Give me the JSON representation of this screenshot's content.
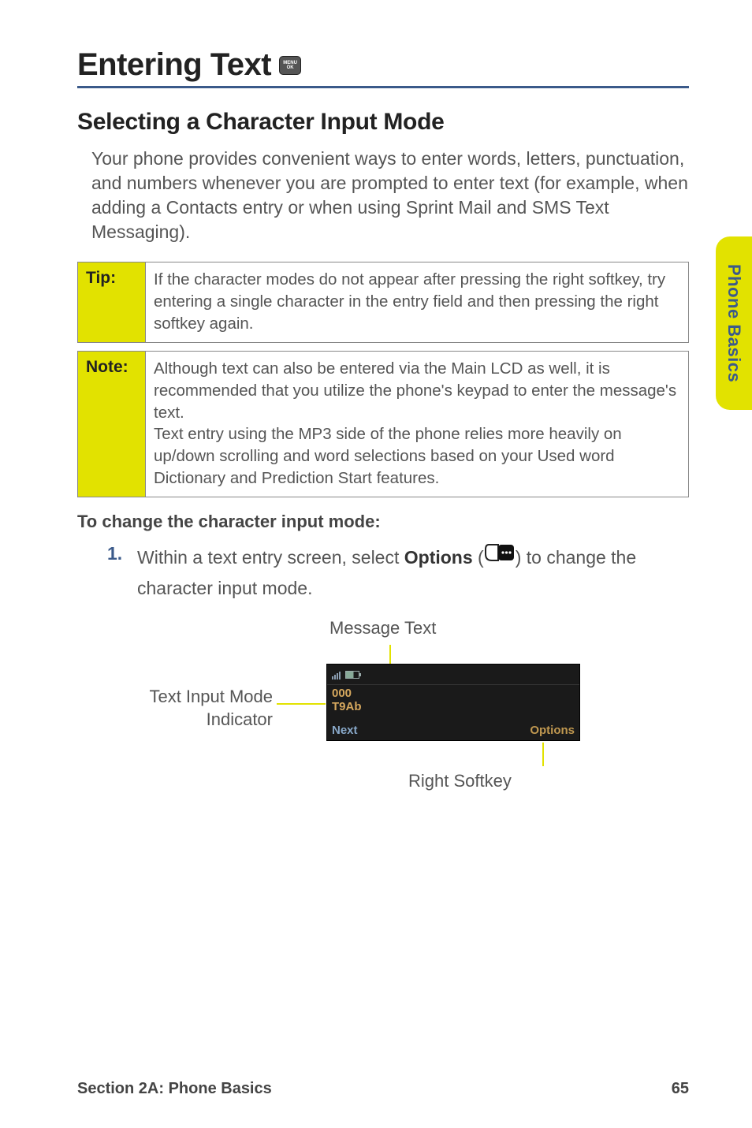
{
  "header": {
    "title": "Entering Text",
    "icon_name": "menu-ok-key-icon"
  },
  "section_heading": "Selecting a Character Input Mode",
  "intro_paragraph": "Your phone provides convenient ways to enter words, letters, punctuation, and numbers whenever you are prompted to enter text (for example, when adding a Contacts entry or when using Sprint Mail and SMS Text Messaging).",
  "tip_box": {
    "label": "Tip:",
    "text": "If the character modes do not appear after pressing the right softkey, try entering a single character in the entry field and then pressing the right softkey again."
  },
  "note_box": {
    "label": "Note:",
    "text_line1": "Although text can also be entered via the Main LCD as well, it is recommended that you utilize the phone's keypad to enter the message's text.",
    "text_line2": "Text entry using the MP3 side of the phone relies more heavily on up/down scrolling and word selections based on your Used word Dictionary and Prediction Start features."
  },
  "procedure_heading": "To change the character input mode:",
  "step1": {
    "number": "1.",
    "text_before": "Within a text entry screen, select ",
    "bold_word": "Options",
    "text_after_paren_open": " (",
    "text_after_paren_close": ") to change the character input mode."
  },
  "figure": {
    "message_text_label": "Message Text",
    "input_mode_label_line1": "Text Input Mode",
    "input_mode_label_line2": "Indicator",
    "right_softkey_label": "Right Softkey",
    "phone": {
      "counter": "000",
      "mode_indicator": "T9Ab",
      "left_softkey": "Next",
      "right_softkey": "Options"
    }
  },
  "side_tab": "Phone Basics",
  "footer": {
    "section_label": "Section 2A: Phone Basics",
    "page_number": "65"
  }
}
